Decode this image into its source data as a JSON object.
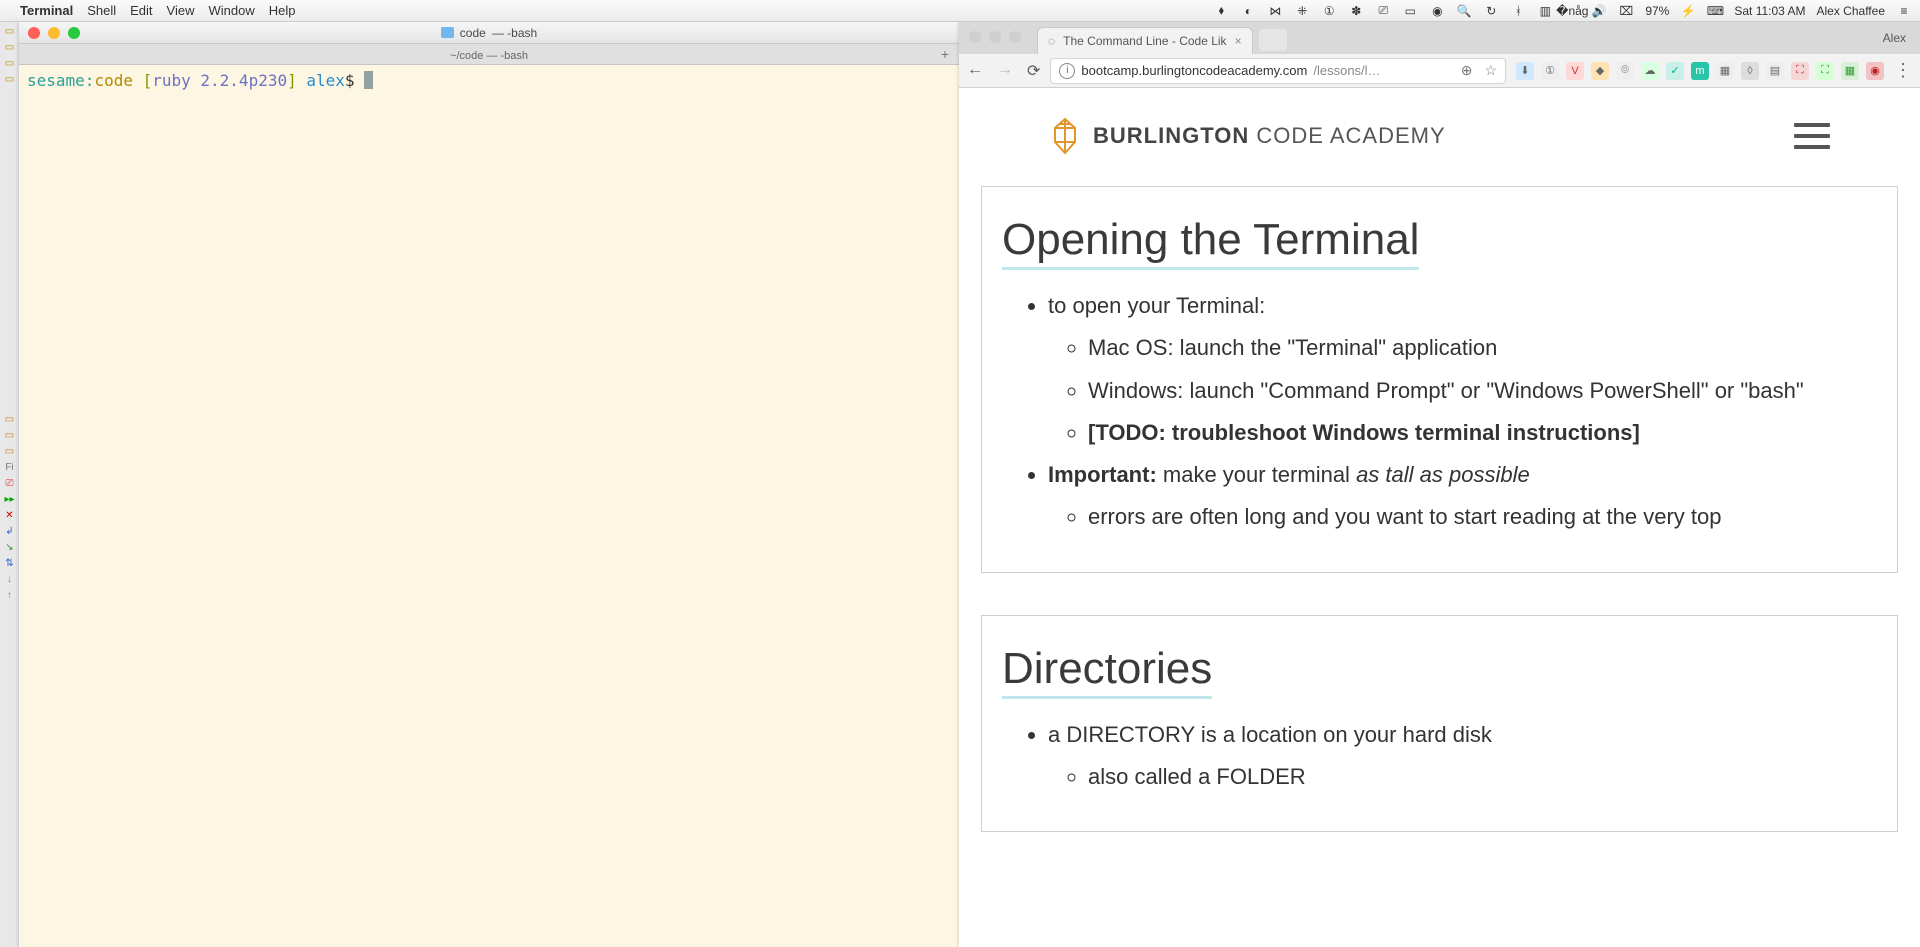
{
  "menubar": {
    "app": "Terminal",
    "items": [
      "Shell",
      "Edit",
      "View",
      "Window",
      "Help"
    ],
    "battery": "97%",
    "clock": "Sat 11:03 AM",
    "username": "Alex Chaffee"
  },
  "terminal": {
    "title_folder": "code",
    "title_suffix": "— -bash",
    "tab_label": "~/code — -bash",
    "plus": "+",
    "prompt_host": "sesame:",
    "prompt_path": "code",
    "prompt_open": " [",
    "prompt_ruby": "ruby 2.2.4p230",
    "prompt_close": "]",
    "prompt_user": " alex",
    "prompt_dollar": "$ "
  },
  "chrome": {
    "tab_title": "The Command Line - Code Lik",
    "tab_close": "×",
    "profile": "Alex",
    "nav_back": "←",
    "nav_fwd": "→",
    "nav_reload": "⟳",
    "url_host": "bootcamp.burlingtoncodeacademy.com",
    "url_path": "/lessons/l…",
    "zoom_glyph": "⊕",
    "star": "☆",
    "info": "i",
    "menu": "⋮"
  },
  "site": {
    "brand_bold": "BURLINGTON",
    "brand_light": " CODE ACADEMY"
  },
  "content": {
    "section1": {
      "heading": "Opening the Terminal",
      "li1": "to open your Terminal:",
      "li1a": "Mac OS: launch the \"Terminal\" application",
      "li1b": "Windows: launch \"Command Prompt\" or \"Windows PowerShell\" or \"bash\"",
      "li1c": "[TODO: troubleshoot Windows terminal instructions]",
      "li2_strong": "Important:",
      "li2_rest": " make your terminal ",
      "li2_em": "as tall as possible",
      "li2a": "errors are often long and you want to start reading at the very top"
    },
    "section2": {
      "heading": "Directories",
      "li1": "a DIRECTORY is a location on your hard disk",
      "li1a": "also called a FOLDER"
    }
  }
}
